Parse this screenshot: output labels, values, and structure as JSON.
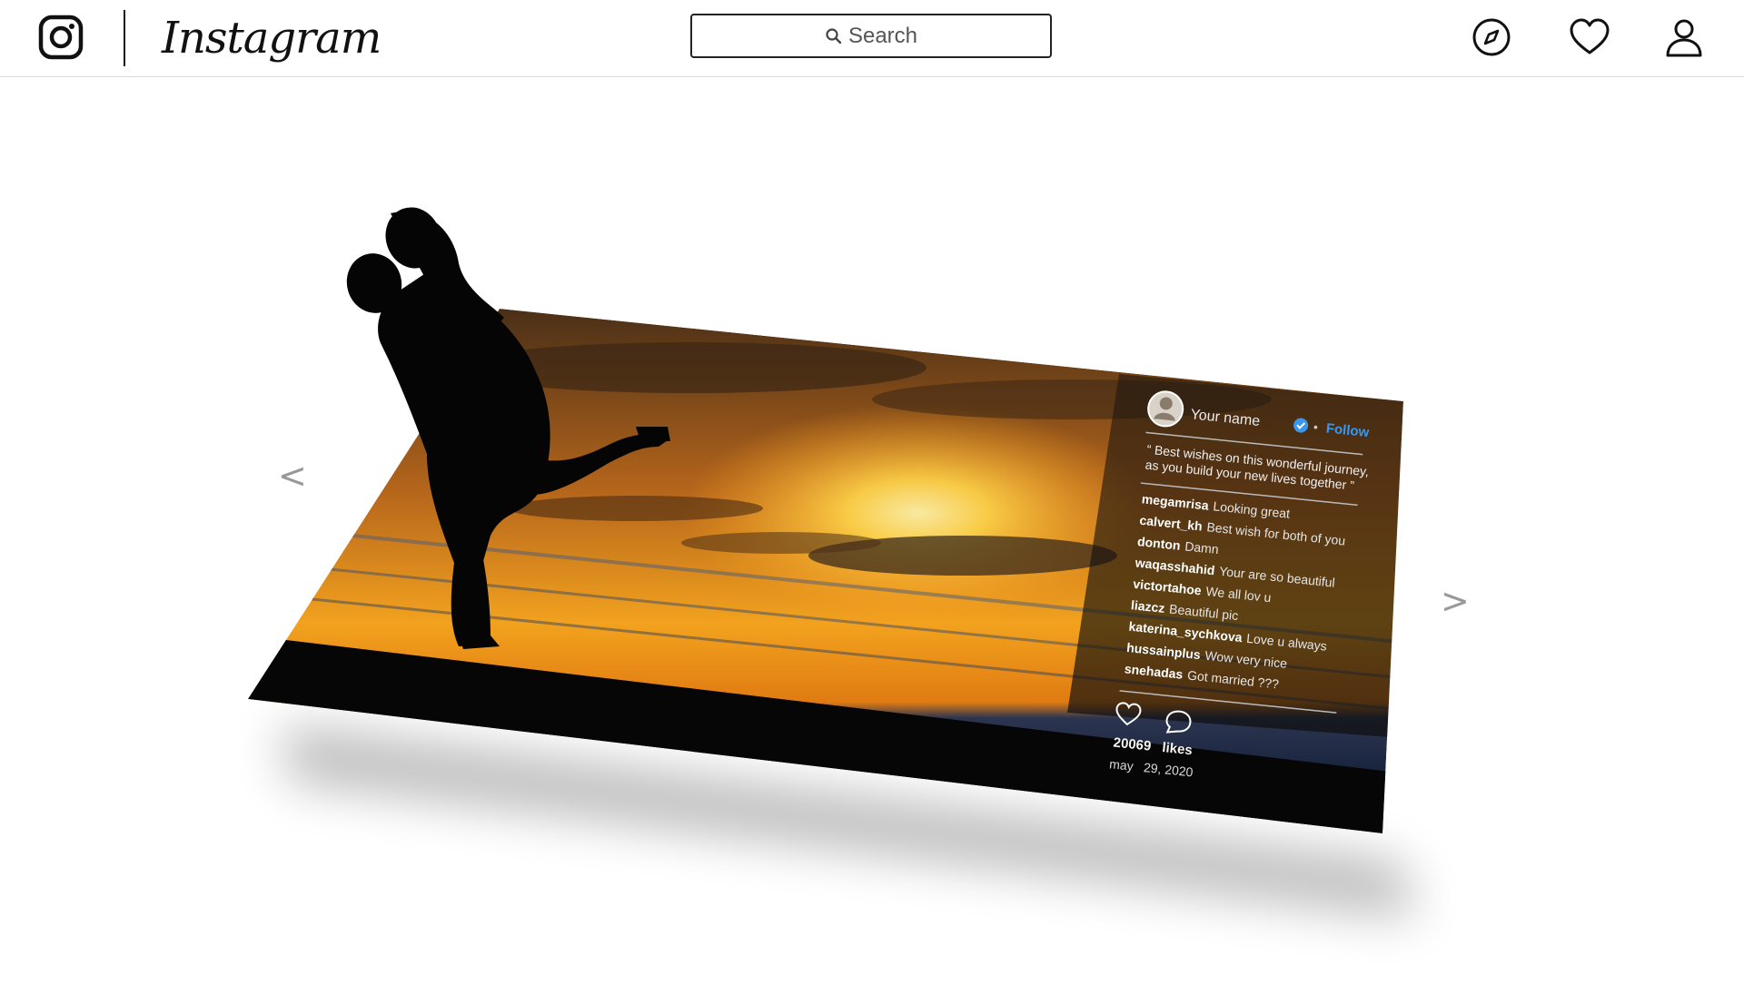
{
  "app": {
    "wordmark": "Instagram"
  },
  "header": {
    "search_placeholder": "Search",
    "icons": [
      "instagram-logo-icon",
      "search-icon",
      "explore-compass-icon",
      "heart-icon",
      "profile-icon"
    ]
  },
  "carousel": {
    "prev": "<",
    "next": ">"
  },
  "post": {
    "username": "Your name",
    "follow_label": "Follow",
    "bullet": "•",
    "caption_line1": "“ Best wishes on this wonderful journey,",
    "caption_line2": "as you build your new lives together ”",
    "comments": [
      {
        "user": "megamrisa",
        "text": "Looking great"
      },
      {
        "user": "calvert_kh",
        "text": "Best wish for both of you"
      },
      {
        "user": "donton",
        "text": "Damn"
      },
      {
        "user": "waqasshahid",
        "text": "Your are so beautiful"
      },
      {
        "user": "victortahoe",
        "text": "We all lov u"
      },
      {
        "user": "liazcz",
        "text": "Beautiful pic"
      },
      {
        "user": "katerina_sychkova",
        "text": "Love u always"
      },
      {
        "user": "hussainplus",
        "text": "Wow very nice"
      },
      {
        "user": "snehadas",
        "text": "Got married ???"
      }
    ],
    "likes_count": "20069",
    "likes_label": "likes",
    "date_month": "may",
    "date_rest": "29, 2020"
  },
  "colors": {
    "follow": "#3897f0",
    "verified": "#3897f0",
    "sky_top": "#5a3a1e",
    "sun": "#ffd54a",
    "sea": "#1b2a44"
  }
}
